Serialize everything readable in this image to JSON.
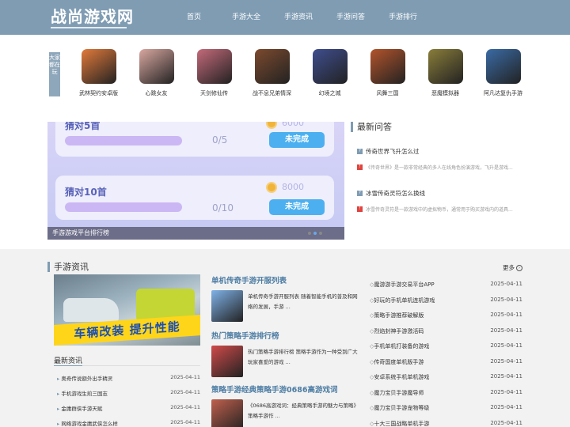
{
  "header": {
    "logo": "战尚游戏网",
    "nav": [
      "首页",
      "手游大全",
      "手游资讯",
      "手游问答",
      "手游排行"
    ]
  },
  "strip": {
    "tag": "大家都在玩",
    "games": [
      {
        "name": "武林契约安卓版",
        "color": "#e27a3a"
      },
      {
        "name": "心跳女友",
        "color": "#d9a7a0"
      },
      {
        "name": "天剑修仙传",
        "color": "#c46a7a"
      },
      {
        "name": "战不息兄弟情深",
        "color": "#7c4a2e"
      },
      {
        "name": "幻境之城",
        "color": "#3f4e8f"
      },
      {
        "name": "风舞三国",
        "color": "#b3542b"
      },
      {
        "name": "恶魔模拟器",
        "color": "#8a7d3a"
      },
      {
        "name": "阿凡达复仇手游",
        "color": "#3a6ba5"
      }
    ]
  },
  "banner": {
    "tasks": [
      {
        "title": "猜对5首",
        "count": "0/5",
        "score": "6000",
        "button": "未完成"
      },
      {
        "title": "猜对10首",
        "count": "0/10",
        "score": "8000",
        "button": "未完成"
      }
    ],
    "caption": "手游游戏平台排行榜"
  },
  "qa": {
    "title": "最新问答",
    "items": [
      {
        "q": "传奇世界飞升怎么过",
        "a": "《传奇世界》是一款非常经典的多人在线角色扮演游戏，飞升是游戏..."
      },
      {
        "q": "冰雪传奇灵符怎么换线",
        "a": "冰雪传奇灵符是一款游戏中的虚拟物币，通常用于购买游戏内的道具..."
      }
    ]
  },
  "news": {
    "title": "手游资讯",
    "more": "更多",
    "hero_text": "车辆改装 提升性能",
    "latest_title": "最新资讯",
    "latest": [
      {
        "t": "奥奇传说额外出手精灵",
        "d": "2025-04-11"
      },
      {
        "t": "手机游戏生煎三国志",
        "d": "2025-04-11"
      },
      {
        "t": "金庸群侠手游天赋",
        "d": "2025-04-11"
      },
      {
        "t": "网络游戏金庸武侠怎么样",
        "d": "2025-04-11"
      }
    ],
    "featured": [
      {
        "title": "单机传奇手游开服列表",
        "desc": "单机传奇手游开服列表 随着智能手机的普及和网络的发展，手游 ...",
        "color": "#7fb2e8"
      },
      {
        "title": "热门策略手游排行榜",
        "desc": "热门策略手游排行榜 策略手游作为一种受到广大玩家喜爱的游戏 ...",
        "color": "#d04a4a"
      },
      {
        "title": "策略手游经典策略手游0686高游戏词",
        "desc": "《0686高游戏词：经典策略手游的魅力与策略》 策略手游作 ...",
        "color": "#c0604d"
      }
    ],
    "list": [
      {
        "t": "魔游游手游交易平台APP",
        "d": "2025-04-11"
      },
      {
        "t": "好玩的手机单机连机游戏",
        "d": "2025-04-11"
      },
      {
        "t": "策略手游推荐破解版",
        "d": "2025-04-11"
      },
      {
        "t": "烈焰封神手游激活码",
        "d": "2025-04-11"
      },
      {
        "t": "手机单机打装备的游戏",
        "d": "2025-04-11"
      },
      {
        "t": "传奇国度单机版手游",
        "d": "2025-04-11"
      },
      {
        "t": "安卓系统手机单机游戏",
        "d": "2025-04-11"
      },
      {
        "t": "魔力宝贝手游魔导师",
        "d": "2025-04-11"
      },
      {
        "t": "魔力宝贝手游宠物等级",
        "d": "2025-04-11"
      },
      {
        "t": "十大三国战略单机手游",
        "d": "2025-04-11"
      }
    ]
  }
}
